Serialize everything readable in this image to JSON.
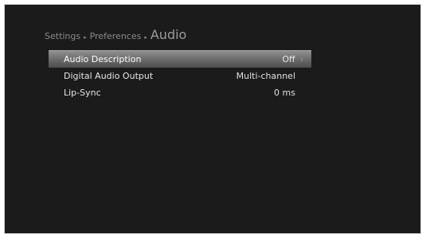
{
  "breadcrumb": {
    "items": [
      "Settings",
      "Preferences"
    ],
    "separator": "▸",
    "current": "Audio"
  },
  "menu": {
    "items": [
      {
        "label": "Audio Description",
        "value": "Off",
        "selected": true,
        "chevron": "›"
      },
      {
        "label": "Digital Audio Output",
        "value": "Multi-channel",
        "selected": false
      },
      {
        "label": "Lip-Sync",
        "value": "0 ms",
        "selected": false
      }
    ]
  },
  "colors": {
    "screen_bg": "#1b1b1b",
    "highlight": "#7a7a7a",
    "text": "#e6e6e6",
    "breadcrumb": "#8a8a8a"
  }
}
